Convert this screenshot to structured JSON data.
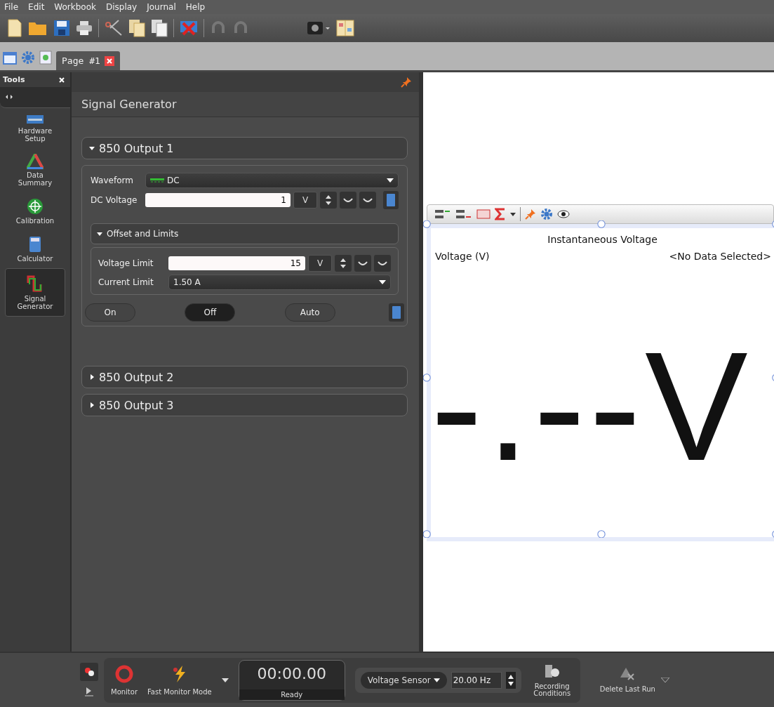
{
  "menu": [
    "File",
    "Edit",
    "Workbook",
    "Display",
    "Journal",
    "Help"
  ],
  "tabs": [
    {
      "label": "Page #1",
      "selected": true
    }
  ],
  "tools": {
    "title": "Tools",
    "items": [
      {
        "label": "Hardware Setup",
        "kind": "hardware",
        "selected": false
      },
      {
        "label": "Data Summary",
        "kind": "summary",
        "selected": false
      },
      {
        "label": "Calibration",
        "kind": "calibration",
        "selected": false
      },
      {
        "label": "Calculator",
        "kind": "calculator",
        "selected": false
      },
      {
        "label": "Signal Generator",
        "kind": "signal",
        "selected": true
      }
    ]
  },
  "signal_generator": {
    "title": "Signal Generator",
    "outputs": [
      {
        "title": "850 Output 1",
        "expanded": true,
        "waveform_label": "Waveform",
        "waveform": "DC",
        "voltage_label": "DC Voltage",
        "voltage": "1",
        "voltage_unit": "V",
        "limits": {
          "title": "Offset and Limits",
          "expanded": true,
          "voltage_limit_label": "Voltage Limit",
          "voltage_limit": "15",
          "voltage_limit_unit": "V",
          "current_limit_label": "Current Limit",
          "current_limit": "1.50 A"
        },
        "modes": [
          {
            "label": "On",
            "selected": false
          },
          {
            "label": "Off",
            "selected": true
          },
          {
            "label": "Auto",
            "selected": false
          }
        ]
      },
      {
        "title": "850 Output 2",
        "expanded": false
      },
      {
        "title": "850 Output 3",
        "expanded": false
      }
    ]
  },
  "display": {
    "title": "Instantaneous Voltage",
    "measurement": "Voltage (V)",
    "source": "<No Data Selected>",
    "reading": "-.--V"
  },
  "controls": {
    "monitor": "Monitor",
    "fast_monitor": "Fast Monitor Mode",
    "timer": "00:00.00",
    "status": "Ready",
    "sensor": "Voltage Sensor",
    "rate": "20.00 Hz",
    "recording": "Recording Conditions",
    "delete": "Delete Last Run"
  }
}
